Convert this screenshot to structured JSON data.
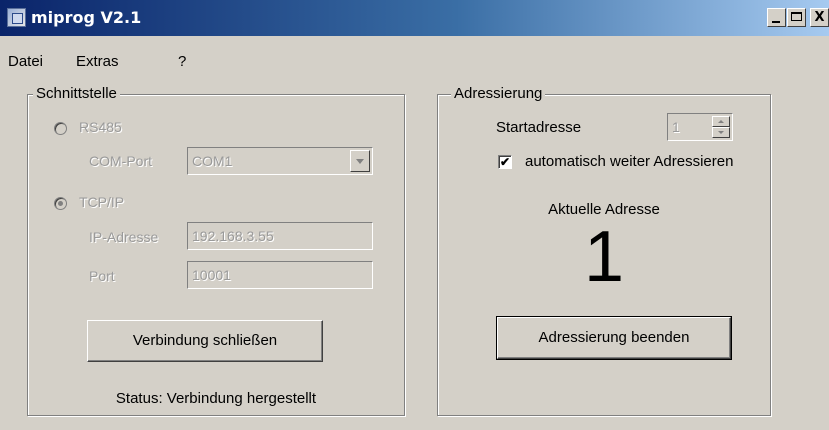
{
  "window": {
    "title": "miprog V2.1",
    "controls": {
      "minimize": "_",
      "maximize": "□",
      "close": "X"
    }
  },
  "menu": [
    "Datei",
    "Extras",
    "?"
  ],
  "schnittstelle": {
    "legend": "Schnittstelle",
    "rs485": {
      "label": "RS485",
      "selected": false,
      "enabled": false
    },
    "com_port": {
      "label": "COM-Port",
      "value": "COM1"
    },
    "tcpip": {
      "label": "TCP/IP",
      "selected": true,
      "enabled": false
    },
    "ip": {
      "label": "IP-Adresse",
      "value": "192.168.3.55"
    },
    "port": {
      "label": "Port",
      "value": "10001"
    },
    "connect_button": "Verbindung schließen",
    "status": "Status: Verbindung hergestellt"
  },
  "adressierung": {
    "legend": "Adressierung",
    "startadresse": {
      "label": "Startadresse",
      "value": "1"
    },
    "auto": {
      "label": "automatisch weiter Adressieren",
      "checked": true,
      "mark": "✔"
    },
    "aktuelle_label": "Aktuelle Adresse",
    "aktuelle_value": "1",
    "stop_button": "Adressierung beenden"
  },
  "colors": {
    "face": "#d4d0c8",
    "title_start": "#0a246a",
    "title_end": "#a6caf0",
    "disabled_text": "#9a9a9a"
  }
}
